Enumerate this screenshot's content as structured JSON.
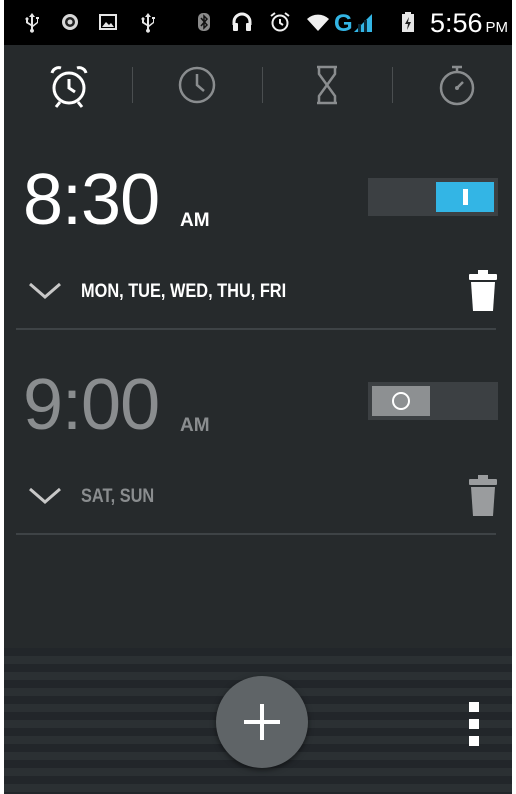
{
  "status_bar": {
    "time": "5:56",
    "ampm": "PM",
    "network_type": "G",
    "icons": [
      "usb-icon",
      "notification-icon",
      "image-icon",
      "usb-icon",
      "bluetooth-icon",
      "headset-icon",
      "alarm-icon",
      "wifi-icon",
      "signal-icon",
      "battery-icon"
    ]
  },
  "tabs": [
    {
      "name": "alarm",
      "icon": "alarm-clock-icon",
      "selected": true
    },
    {
      "name": "clock",
      "icon": "clock-icon",
      "selected": false
    },
    {
      "name": "timer",
      "icon": "hourglass-icon",
      "selected": false
    },
    {
      "name": "stopwatch",
      "icon": "stopwatch-icon",
      "selected": false
    }
  ],
  "alarms": [
    {
      "time": "8:30",
      "ampm": "AM",
      "days": "MON, TUE, WED, THU, FRI",
      "enabled": true,
      "switch_symbol": "I"
    },
    {
      "time": "9:00",
      "ampm": "AM",
      "days": "SAT, SUN",
      "enabled": false,
      "switch_symbol": "O"
    }
  ],
  "colors": {
    "background": "#262a2c",
    "accent": "#33b5e5",
    "text_on": "#ffffff",
    "text_off": "#8a8d8f"
  },
  "fab": {
    "icon": "plus-icon"
  },
  "menu": {
    "icon": "overflow-menu-icon"
  }
}
